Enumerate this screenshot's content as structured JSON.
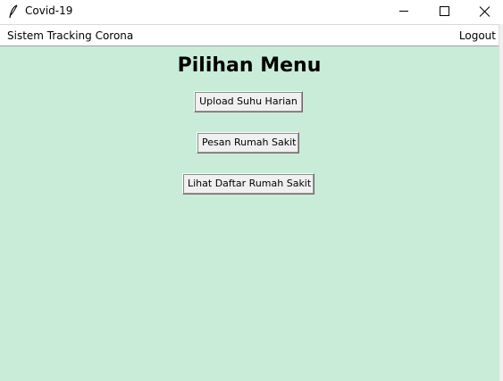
{
  "window": {
    "title": "Covid-19",
    "app_icon": "feather-icon",
    "controls": {
      "minimize_icon": "minimize-icon",
      "maximize_icon": "maximize-icon",
      "close_icon": "close-icon"
    }
  },
  "menubar": {
    "left_label": "Sistem Tracking Corona",
    "right_label": "Logout"
  },
  "main": {
    "heading": "Pilihan Menu",
    "buttons": [
      {
        "label": "Upload Suhu Harian"
      },
      {
        "label": "Pesan Rumah Sakit"
      },
      {
        "label": "Lihat Daftar Rumah Sakit"
      }
    ]
  },
  "colors": {
    "content_background": "#c8ecd8",
    "button_face": "#f0f0f0"
  }
}
